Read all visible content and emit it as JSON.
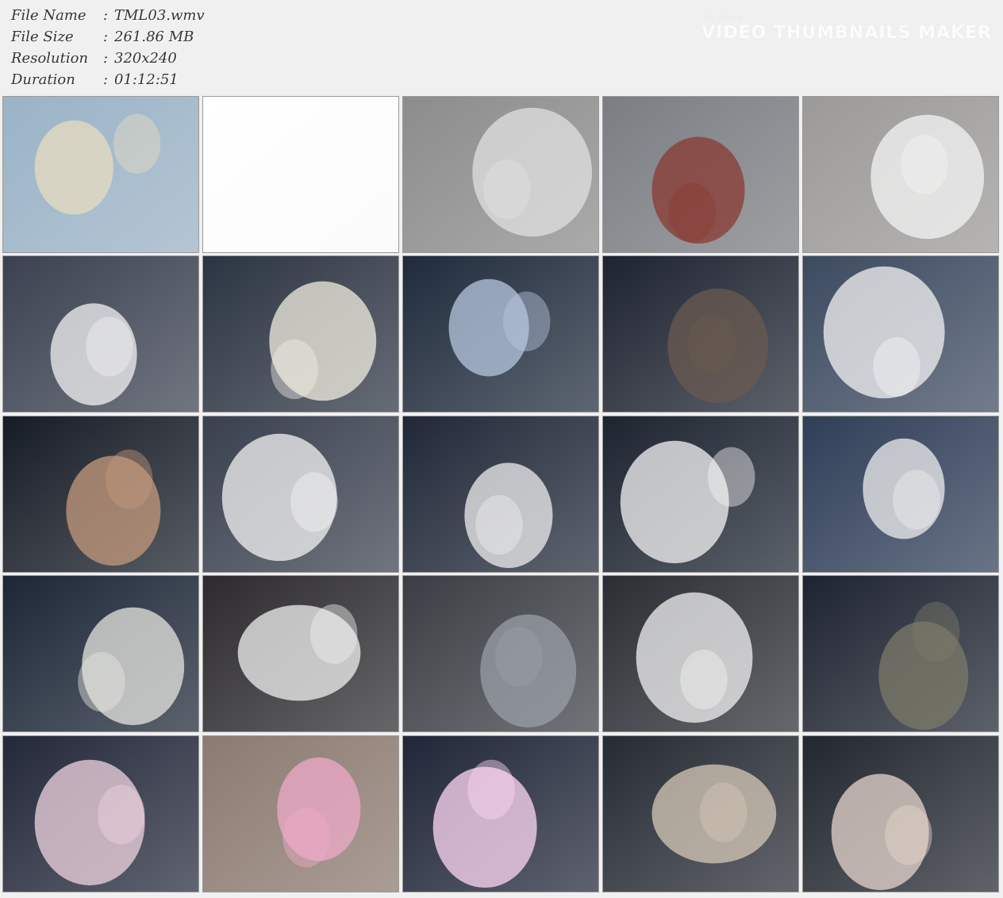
{
  "header": {
    "rows": [
      {
        "label": "File Name",
        "sep": ":",
        "value": "TML03.wmv"
      },
      {
        "label": "File Size",
        "sep": ":",
        "value": "261.86 MB"
      },
      {
        "label": "Resolution",
        "sep": ":",
        "value": "320x240"
      },
      {
        "label": "Duration",
        "sep": ":",
        "value": "01:12:51"
      }
    ],
    "brand_by": "by Scorp",
    "brand_title": "VIDEO THUMBNAILS MAKER"
  },
  "thumbnails": [
    {
      "scene": "hero-kick-outdoors",
      "bg": "#9ab3c7",
      "fg": "#e8dcc0"
    },
    {
      "scene": "blank-white-frame",
      "bg": "#ffffff",
      "fg": "#ffffff"
    },
    {
      "scene": "office-woman-monochrome",
      "bg": "#8c8c8c",
      "fg": "#e0e0e0"
    },
    {
      "scene": "armored-villain-under-bridge",
      "bg": "#7a7d82",
      "fg": "#8a3a32"
    },
    {
      "scene": "hero-grabbed-by-monster",
      "bg": "#9c9a98",
      "fg": "#f4f4f4"
    },
    {
      "scene": "villain-embraces-hero",
      "bg": "#3a4150",
      "fg": "#f2f2f2"
    },
    {
      "scene": "villain-grabs-hero-leg",
      "bg": "#2b3442",
      "fg": "#f0ede0"
    },
    {
      "scene": "hero-chained-in-cage",
      "bg": "#1f2b3c",
      "fg": "#b7c7de"
    },
    {
      "scene": "villain-face-dark",
      "bg": "#1d2330",
      "fg": "#6a5a50"
    },
    {
      "scene": "hero-legs-chained",
      "bg": "#3c4a60",
      "fg": "#f3f3f3"
    },
    {
      "scene": "villain-laughing-closeup",
      "bg": "#161c26",
      "fg": "#c49a7c"
    },
    {
      "scene": "chained-boot-weight",
      "bg": "#39404e",
      "fg": "#f3f3f3"
    },
    {
      "scene": "villain-and-masked-hero",
      "bg": "#202838",
      "fg": "#eeeeee"
    },
    {
      "scene": "villain-white-gloves",
      "bg": "#1c2430",
      "fg": "#f4f4f4"
    },
    {
      "scene": "hero-arms-raised-chained",
      "bg": "#2f3e58",
      "fg": "#eeeeee"
    },
    {
      "scene": "hero-between-captors",
      "bg": "#1c2636",
      "fg": "#e6e6e0"
    },
    {
      "scene": "masked-hero-lying",
      "bg": "#2c2a2e",
      "fg": "#f0f0f0"
    },
    {
      "scene": "robot-head-closeup",
      "bg": "#3a3e44",
      "fg": "#9a9fa6"
    },
    {
      "scene": "hero-unconscious",
      "bg": "#2a2d33",
      "fg": "#f2f2f2"
    },
    {
      "scene": "monster-machine-red-light",
      "bg": "#1d2330",
      "fg": "#7c7a68"
    },
    {
      "scene": "hero-pink-stained",
      "bg": "#23283a",
      "fg": "#f0d4e0"
    },
    {
      "scene": "pink-masked-closeup",
      "bg": "#8c7a70",
      "fg": "#eeaac8"
    },
    {
      "scene": "energy-burst",
      "bg": "#202638",
      "fg": "#ffd8f4"
    },
    {
      "scene": "hero-lying-on-machine",
      "bg": "#262b33",
      "fg": "#d6c8b8"
    },
    {
      "scene": "masked-captors-and-hero",
      "bg": "#22272f",
      "fg": "#e6d6cc"
    }
  ]
}
